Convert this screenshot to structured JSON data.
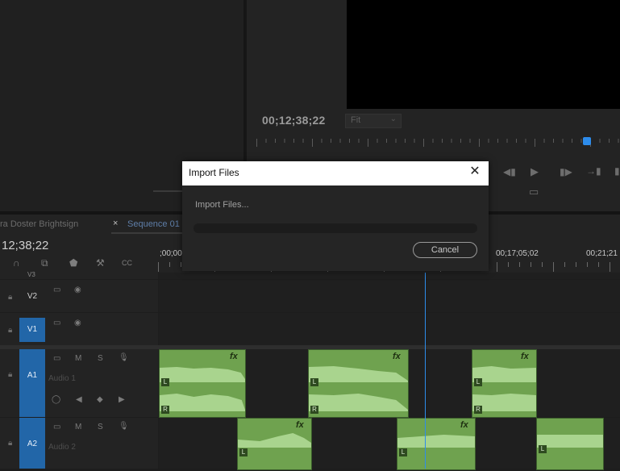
{
  "program_monitor": {
    "timecode": "00;12;38;22",
    "fit_value": "Fit",
    "fit_chevron": "⌄",
    "playhead_fraction": 0.91
  },
  "timeline": {
    "tab_previous": "ra Doster Brightsign",
    "tab_close": "×",
    "tab_active": "Sequence 01",
    "timecode": "12;38;22",
    "ruler_labels": [
      ";00;00",
      "00;17;05;02",
      "00;21;21"
    ],
    "tracks": {
      "v3": "V3",
      "v2": "V2",
      "v1": "V1",
      "a1": "A1",
      "a1_name": "Audio 1",
      "a2": "A2",
      "a2_name": "Audio 2"
    },
    "channel_left": "L",
    "channel_right": "R",
    "fx_label": "fx",
    "toggle_m": "M",
    "toggle_s": "S"
  },
  "dialog": {
    "title": "Import Files",
    "close": "✕",
    "message": "Import Files...",
    "progress": 0.0,
    "cancel_label": "Cancel"
  },
  "colors": {
    "accent": "#2d8ceb",
    "audio_clip": "#6fa24f",
    "track_target": "#2266a8"
  }
}
